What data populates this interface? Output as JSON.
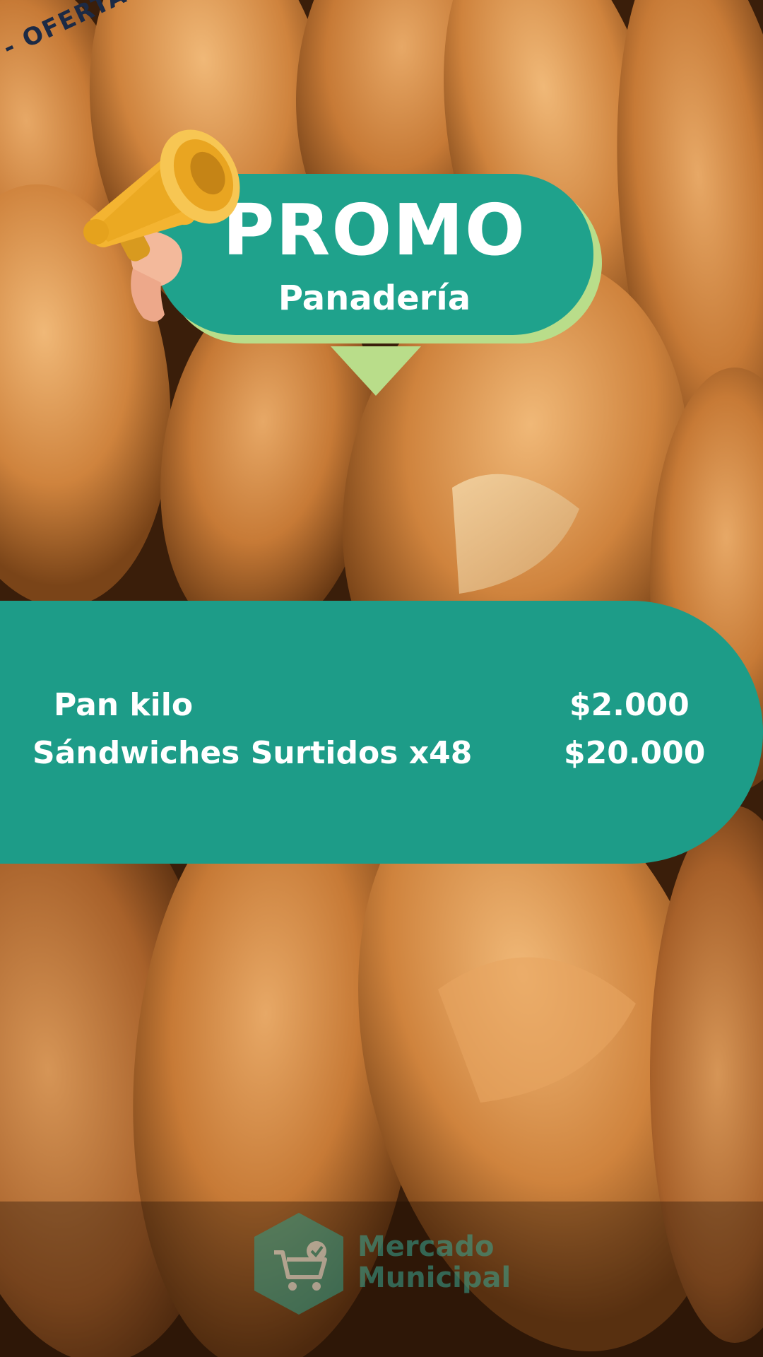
{
  "ribbon": {
    "text": "A - OFERTA - OFERTA - OFERTA - OFE"
  },
  "promo": {
    "title": "PROMO",
    "subtitle": "Panadería"
  },
  "items": [
    {
      "name": "Pan kilo",
      "price": "$2.000"
    },
    {
      "name": "Sándwiches Surtidos x48",
      "price": "$20.000"
    }
  ],
  "logo": {
    "line1": "Mercado",
    "line2": "Municipal"
  },
  "icons": {
    "megaphone": "megaphone-icon",
    "cart": "shopping-cart-icon"
  },
  "colors": {
    "teal": "#1d9c88",
    "light_green": "#b9dd8a",
    "text_white": "#ffffff",
    "ribbon_text": "#1c2a45"
  }
}
